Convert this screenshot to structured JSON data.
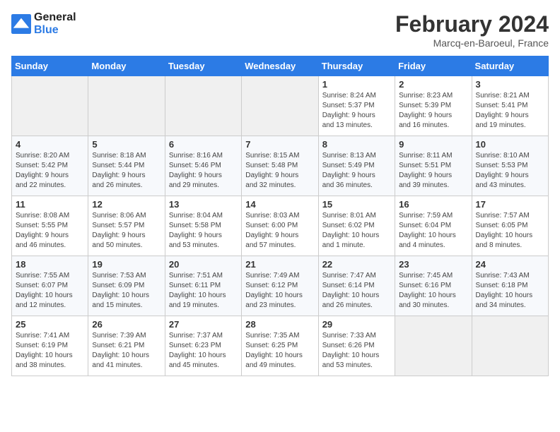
{
  "logo": {
    "line1": "General",
    "line2": "Blue"
  },
  "calendar": {
    "title": "February 2024",
    "subtitle": "Marcq-en-Baroeul, France"
  },
  "days_of_week": [
    "Sunday",
    "Monday",
    "Tuesday",
    "Wednesday",
    "Thursday",
    "Friday",
    "Saturday"
  ],
  "weeks": [
    [
      {
        "num": "",
        "info": ""
      },
      {
        "num": "",
        "info": ""
      },
      {
        "num": "",
        "info": ""
      },
      {
        "num": "",
        "info": ""
      },
      {
        "num": "1",
        "info": "Sunrise: 8:24 AM\nSunset: 5:37 PM\nDaylight: 9 hours\nand 13 minutes."
      },
      {
        "num": "2",
        "info": "Sunrise: 8:23 AM\nSunset: 5:39 PM\nDaylight: 9 hours\nand 16 minutes."
      },
      {
        "num": "3",
        "info": "Sunrise: 8:21 AM\nSunset: 5:41 PM\nDaylight: 9 hours\nand 19 minutes."
      }
    ],
    [
      {
        "num": "4",
        "info": "Sunrise: 8:20 AM\nSunset: 5:42 PM\nDaylight: 9 hours\nand 22 minutes."
      },
      {
        "num": "5",
        "info": "Sunrise: 8:18 AM\nSunset: 5:44 PM\nDaylight: 9 hours\nand 26 minutes."
      },
      {
        "num": "6",
        "info": "Sunrise: 8:16 AM\nSunset: 5:46 PM\nDaylight: 9 hours\nand 29 minutes."
      },
      {
        "num": "7",
        "info": "Sunrise: 8:15 AM\nSunset: 5:48 PM\nDaylight: 9 hours\nand 32 minutes."
      },
      {
        "num": "8",
        "info": "Sunrise: 8:13 AM\nSunset: 5:49 PM\nDaylight: 9 hours\nand 36 minutes."
      },
      {
        "num": "9",
        "info": "Sunrise: 8:11 AM\nSunset: 5:51 PM\nDaylight: 9 hours\nand 39 minutes."
      },
      {
        "num": "10",
        "info": "Sunrise: 8:10 AM\nSunset: 5:53 PM\nDaylight: 9 hours\nand 43 minutes."
      }
    ],
    [
      {
        "num": "11",
        "info": "Sunrise: 8:08 AM\nSunset: 5:55 PM\nDaylight: 9 hours\nand 46 minutes."
      },
      {
        "num": "12",
        "info": "Sunrise: 8:06 AM\nSunset: 5:57 PM\nDaylight: 9 hours\nand 50 minutes."
      },
      {
        "num": "13",
        "info": "Sunrise: 8:04 AM\nSunset: 5:58 PM\nDaylight: 9 hours\nand 53 minutes."
      },
      {
        "num": "14",
        "info": "Sunrise: 8:03 AM\nSunset: 6:00 PM\nDaylight: 9 hours\nand 57 minutes."
      },
      {
        "num": "15",
        "info": "Sunrise: 8:01 AM\nSunset: 6:02 PM\nDaylight: 10 hours\nand 1 minute."
      },
      {
        "num": "16",
        "info": "Sunrise: 7:59 AM\nSunset: 6:04 PM\nDaylight: 10 hours\nand 4 minutes."
      },
      {
        "num": "17",
        "info": "Sunrise: 7:57 AM\nSunset: 6:05 PM\nDaylight: 10 hours\nand 8 minutes."
      }
    ],
    [
      {
        "num": "18",
        "info": "Sunrise: 7:55 AM\nSunset: 6:07 PM\nDaylight: 10 hours\nand 12 minutes."
      },
      {
        "num": "19",
        "info": "Sunrise: 7:53 AM\nSunset: 6:09 PM\nDaylight: 10 hours\nand 15 minutes."
      },
      {
        "num": "20",
        "info": "Sunrise: 7:51 AM\nSunset: 6:11 PM\nDaylight: 10 hours\nand 19 minutes."
      },
      {
        "num": "21",
        "info": "Sunrise: 7:49 AM\nSunset: 6:12 PM\nDaylight: 10 hours\nand 23 minutes."
      },
      {
        "num": "22",
        "info": "Sunrise: 7:47 AM\nSunset: 6:14 PM\nDaylight: 10 hours\nand 26 minutes."
      },
      {
        "num": "23",
        "info": "Sunrise: 7:45 AM\nSunset: 6:16 PM\nDaylight: 10 hours\nand 30 minutes."
      },
      {
        "num": "24",
        "info": "Sunrise: 7:43 AM\nSunset: 6:18 PM\nDaylight: 10 hours\nand 34 minutes."
      }
    ],
    [
      {
        "num": "25",
        "info": "Sunrise: 7:41 AM\nSunset: 6:19 PM\nDaylight: 10 hours\nand 38 minutes."
      },
      {
        "num": "26",
        "info": "Sunrise: 7:39 AM\nSunset: 6:21 PM\nDaylight: 10 hours\nand 41 minutes."
      },
      {
        "num": "27",
        "info": "Sunrise: 7:37 AM\nSunset: 6:23 PM\nDaylight: 10 hours\nand 45 minutes."
      },
      {
        "num": "28",
        "info": "Sunrise: 7:35 AM\nSunset: 6:25 PM\nDaylight: 10 hours\nand 49 minutes."
      },
      {
        "num": "29",
        "info": "Sunrise: 7:33 AM\nSunset: 6:26 PM\nDaylight: 10 hours\nand 53 minutes."
      },
      {
        "num": "",
        "info": ""
      },
      {
        "num": "",
        "info": ""
      }
    ]
  ]
}
